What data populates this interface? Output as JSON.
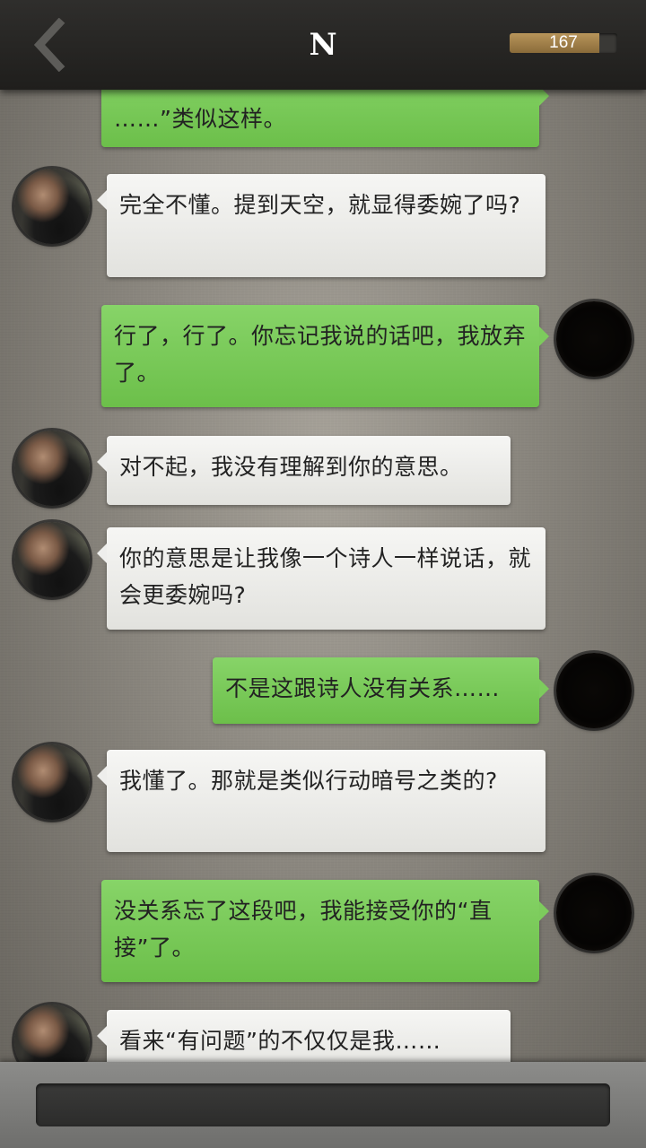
{
  "header": {
    "title": "N",
    "score": "167",
    "score_fill_fraction": 0.83,
    "back_icon": "chevron-left-icon"
  },
  "messages": [
    {
      "side": "right",
      "text": "……”类似这样。"
    },
    {
      "side": "left",
      "text": "完全不懂。提到天空，就显得委婉了吗?"
    },
    {
      "side": "right",
      "text": "行了，行了。你忘记我说的话吧，我放弃了。"
    },
    {
      "side": "left",
      "text": "对不起，我没有理解到你的意思。"
    },
    {
      "side": "left",
      "text": "你的意思是让我像一个诗人一样说话，就会更委婉吗?"
    },
    {
      "side": "right",
      "text": "不是这跟诗人没有关系……"
    },
    {
      "side": "left",
      "text": "我懂了。那就是类似行动暗号之类的?"
    },
    {
      "side": "right",
      "text": "没关系忘了这段吧，我能接受你的“直接”了。"
    },
    {
      "side": "left",
      "text": "看来“有问题”的不仅仅是我……"
    }
  ],
  "input": {
    "value": "",
    "placeholder": ""
  },
  "colors": {
    "header_bg": "#252422",
    "bubble_green": "#7dcb5d",
    "bubble_white": "#eeeeec",
    "background": "#9c978d",
    "score_fill": "#b08c52"
  }
}
